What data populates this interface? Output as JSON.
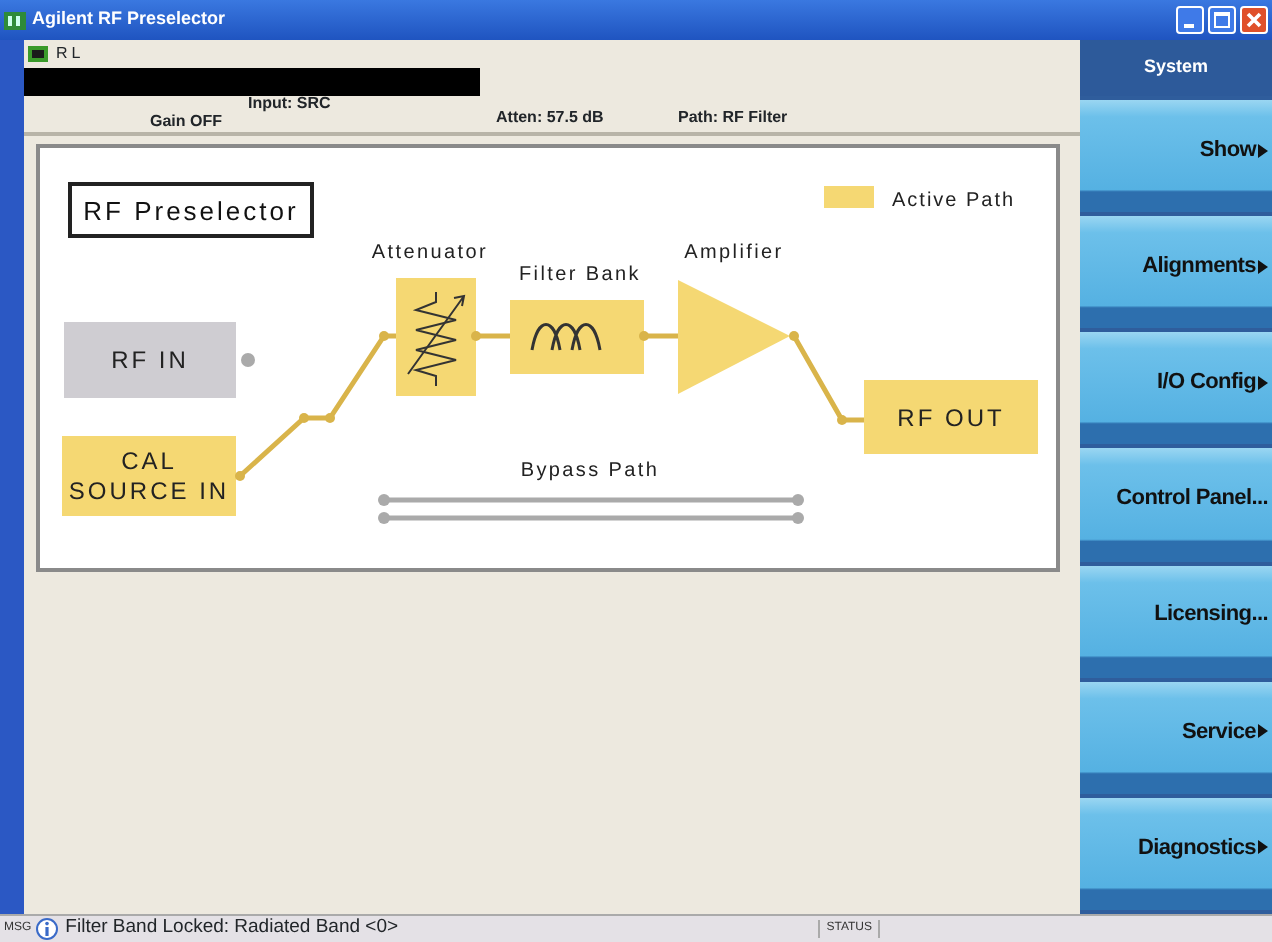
{
  "window": {
    "title": "Agilent RF Preselector"
  },
  "header": {
    "indicator": "RL",
    "input": "Input: SRC",
    "gain": "Gain OFF",
    "atten": "Atten: 57.5 dB",
    "path": "Path: RF Filter"
  },
  "diagram": {
    "title": "RF Preselector",
    "legend": {
      "label": "Active Path"
    },
    "inputs": [
      {
        "lines": [
          "RF IN"
        ],
        "active": false
      },
      {
        "lines": [
          "CAL",
          "SOURCE IN"
        ],
        "active": true
      }
    ],
    "stages": [
      {
        "kind": "attenuator",
        "label": "Attenuator",
        "active": true
      },
      {
        "kind": "filter",
        "label": "Filter Bank",
        "active": true
      },
      {
        "kind": "amplifier",
        "label": "Amplifier",
        "active": true
      }
    ],
    "output": {
      "lines": [
        "RF OUT"
      ],
      "active": true
    },
    "bypass": {
      "label": "Bypass Path",
      "active": false
    }
  },
  "softkeys": {
    "title": "System",
    "buttons": [
      {
        "label": "Show",
        "submenu": true
      },
      {
        "label": "Alignments",
        "submenu": true
      },
      {
        "label": "I/O Config",
        "submenu": true
      },
      {
        "label": "Control Panel...",
        "submenu": false
      },
      {
        "label": "Licensing...",
        "submenu": false
      },
      {
        "label": "Service",
        "submenu": true
      },
      {
        "label": "Diagnostics",
        "submenu": true
      }
    ]
  },
  "status_bar": {
    "tag": "MSG",
    "message": "Filter Band Locked: Radiated Band <0>",
    "status": "STATUS"
  }
}
